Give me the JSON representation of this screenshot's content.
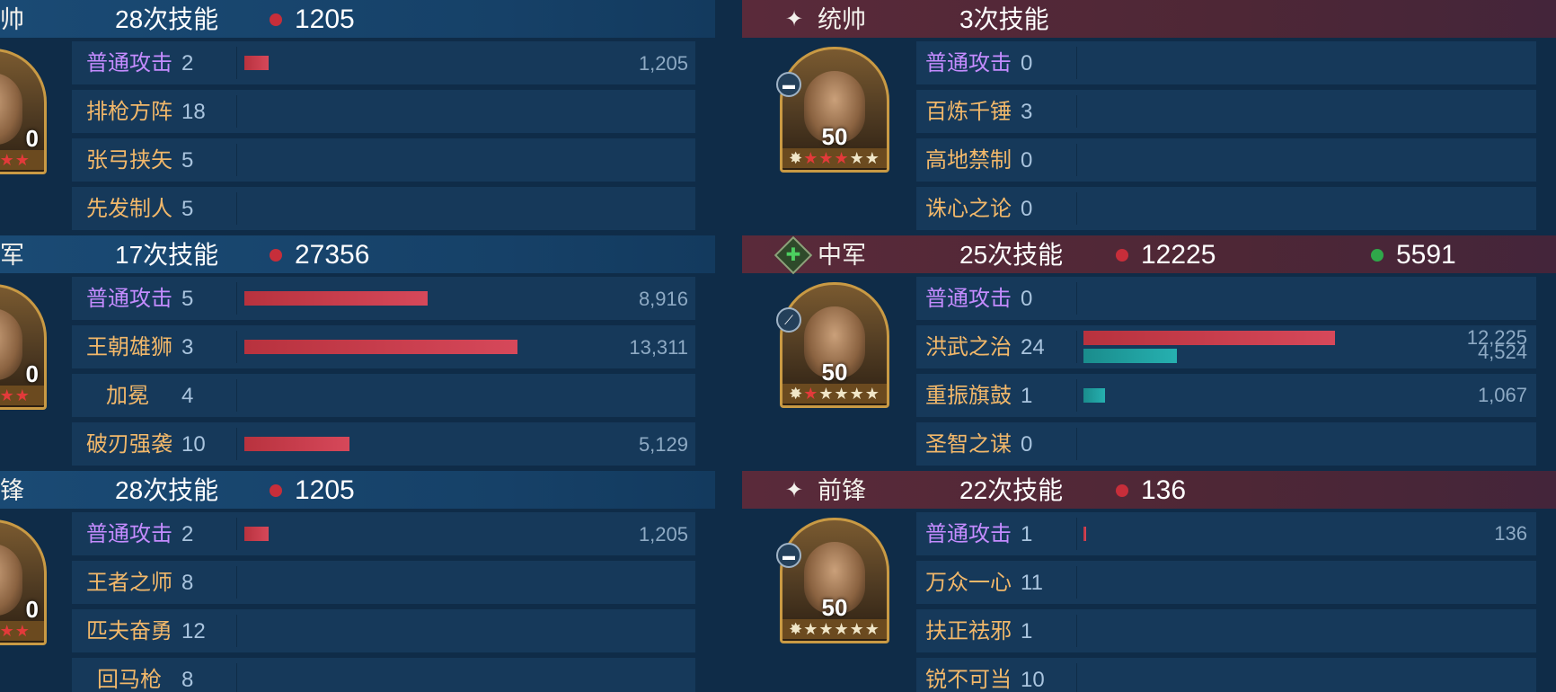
{
  "colors": {
    "attack_label": "#c48cff",
    "skill_label": "#f2b86a",
    "damage_dot": "#c72e3a",
    "heal_dot": "#2fa84a",
    "left_header_bg": "#16426a",
    "right_header_bg": "#5e2c3c"
  },
  "left": {
    "sections": [
      {
        "role": "帅",
        "skill_count": "28次技能",
        "damage": "1205",
        "level": "0",
        "skills": [
          {
            "name": "普通攻击",
            "count": "2",
            "value": "1,205",
            "bar": 0.09,
            "type": "attack"
          },
          {
            "name": "排枪方阵",
            "count": "18",
            "value": "",
            "bar": 0,
            "type": "skill"
          },
          {
            "name": "张弓挟矢",
            "count": "5",
            "value": "",
            "bar": 0,
            "type": "skill"
          },
          {
            "name": "先发制人",
            "count": "5",
            "value": "",
            "bar": 0,
            "type": "skill"
          }
        ]
      },
      {
        "role": "军",
        "skill_count": "17次技能",
        "damage": "27356",
        "level": "0",
        "skills": [
          {
            "name": "普通攻击",
            "count": "5",
            "value": "8,916",
            "bar": 0.67,
            "type": "attack"
          },
          {
            "name": "王朝雄狮",
            "count": "3",
            "value": "13,311",
            "bar": 1.0,
            "type": "skill"
          },
          {
            "name": "加冕",
            "count": "4",
            "value": "",
            "bar": 0,
            "type": "skill"
          },
          {
            "name": "破刃强袭",
            "count": "10",
            "value": "5,129",
            "bar": 0.385,
            "type": "skill"
          }
        ]
      },
      {
        "role": "锋",
        "skill_count": "28次技能",
        "damage": "1205",
        "level": "0",
        "skills": [
          {
            "name": "普通攻击",
            "count": "2",
            "value": "1,205",
            "bar": 0.09,
            "type": "attack"
          },
          {
            "name": "王者之师",
            "count": "8",
            "value": "",
            "bar": 0,
            "type": "skill"
          },
          {
            "name": "匹夫奋勇",
            "count": "12",
            "value": "",
            "bar": 0,
            "type": "skill"
          },
          {
            "name": "回马枪",
            "count": "8",
            "value": "",
            "bar": 0,
            "type": "skill"
          }
        ]
      }
    ]
  },
  "right": {
    "sections": [
      {
        "role": "统帅",
        "role_icon": "sparkle-icon",
        "skill_count": "3次技能",
        "damage": "",
        "heal": "",
        "level": "50",
        "unit_icon": "tank-icon",
        "stars_red": 3,
        "skills": [
          {
            "name": "普通攻击",
            "count": "0",
            "values": [],
            "type": "attack"
          },
          {
            "name": "百炼千锤",
            "count": "3",
            "values": [],
            "type": "skill"
          },
          {
            "name": "高地禁制",
            "count": "0",
            "values": [],
            "type": "skill"
          },
          {
            "name": "诛心之论",
            "count": "0",
            "values": [],
            "type": "skill"
          }
        ]
      },
      {
        "role": "中军",
        "role_icon": "heal-cross-icon",
        "skill_count": "25次技能",
        "damage": "12225",
        "heal": "5591",
        "level": "50",
        "unit_icon": "rifle-icon",
        "stars_red": 1,
        "skills": [
          {
            "name": "普通攻击",
            "count": "0",
            "values": [],
            "type": "attack"
          },
          {
            "name": "洪武之治",
            "count": "24",
            "values": [
              {
                "v": "12,225",
                "bar": 1.0,
                "kind": "damage"
              },
              {
                "v": "4,524",
                "bar": 0.37,
                "kind": "heal"
              }
            ],
            "type": "skill"
          },
          {
            "name": "重振旗鼓",
            "count": "1",
            "values": [
              {
                "v": "1,067",
                "bar": 0.087,
                "kind": "heal"
              }
            ],
            "type": "skill"
          },
          {
            "name": "圣智之谋",
            "count": "0",
            "values": [],
            "type": "skill"
          }
        ]
      },
      {
        "role": "前锋",
        "role_icon": "sparkle-icon",
        "skill_count": "22次技能",
        "damage": "136",
        "heal": "",
        "level": "50",
        "unit_icon": "tank-icon",
        "stars_red": 0,
        "skills": [
          {
            "name": "普通攻击",
            "count": "1",
            "values": [
              {
                "v": "136",
                "bar": 0.011,
                "kind": "damage"
              }
            ],
            "type": "attack"
          },
          {
            "name": "万众一心",
            "count": "11",
            "values": [],
            "type": "skill"
          },
          {
            "name": "扶正祛邪",
            "count": "1",
            "values": [],
            "type": "skill"
          },
          {
            "name": "锐不可当",
            "count": "10",
            "values": [],
            "type": "skill"
          }
        ]
      }
    ]
  }
}
